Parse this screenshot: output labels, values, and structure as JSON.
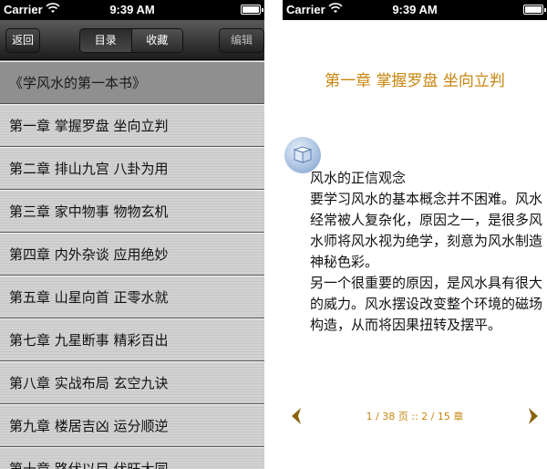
{
  "status": {
    "carrier": "Carrier",
    "time": "9:39 AM"
  },
  "left": {
    "nav": {
      "back": "返回",
      "segments": [
        "目录",
        "收藏"
      ],
      "edit": "编辑"
    },
    "book_title": "《学风水的第一本书》",
    "chapters": [
      "第一章 掌握罗盘 坐向立判",
      "第二章 排山九宫 八卦为用",
      "第三章 家中物事 物物玄机",
      "第四章 内外杂谈 应用绝妙",
      "第五章 山星向首 正零水就",
      "第七章 九星断事 精彩百出",
      "第八章 实战布局 玄空九诀",
      "第九章 楼居吉凶 运分顺逆",
      "第十章 路伏以目 伏旺大同"
    ]
  },
  "right": {
    "chapter_title": "第一章 掌握罗盘 坐向立判",
    "paragraphs": [
      {
        "text": "风水的正信观念",
        "indent": true
      },
      {
        "text": "要学习风水的基本概念并不困难。风水经常被人复杂化，原因之一，是很多风水师将风水视为绝学，刻意为风水制造神秘色彩。",
        "indent": true
      },
      {
        "text": "另一个很重要的原因，是风水具有很大的威力。风水摆设改变整个环境的磁场构造，从而将因果扭转及摆平。",
        "indent": true
      }
    ],
    "pager": "1 / 38 页 :: 2 / 15 章"
  },
  "colors": {
    "accent": "#c8860f"
  }
}
